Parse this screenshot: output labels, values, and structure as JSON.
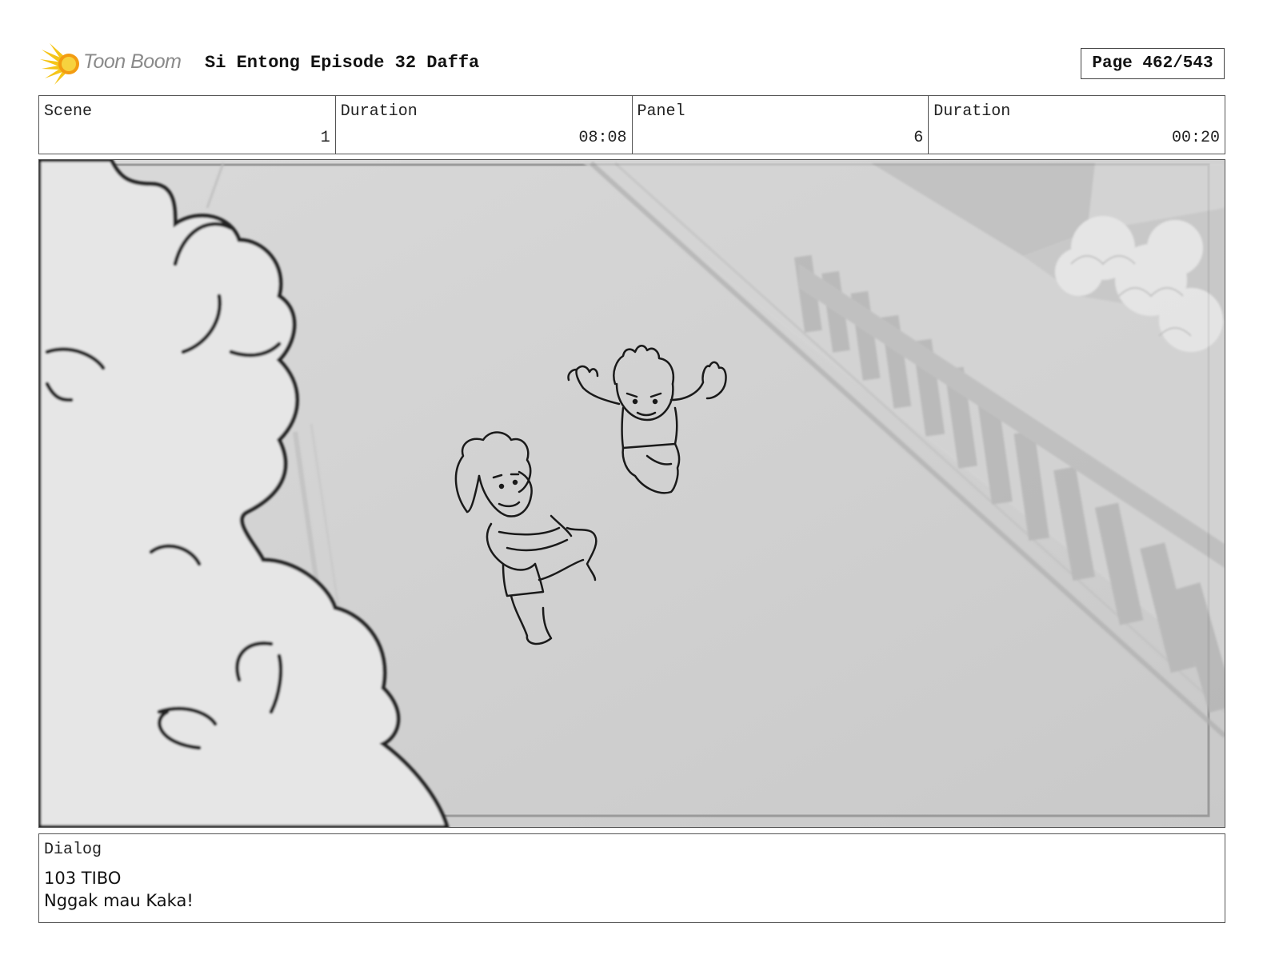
{
  "header": {
    "logo_text": "Toon Boom",
    "project_title": "Si Entong Episode 32 Daffa",
    "page": "Page 462/543"
  },
  "info": {
    "scene_label": "Scene",
    "scene_value": "1",
    "scene_duration_label": "Duration",
    "scene_duration_value": "08:08",
    "panel_label": "Panel",
    "panel_value": "6",
    "panel_duration_label": "Duration",
    "panel_duration_value": "00:20"
  },
  "dialog": {
    "label": "Dialog",
    "line1": "103 TIBO",
    "line2": "Nggak mau Kaka!"
  },
  "colors": {
    "logo_yellow": "#f5c518",
    "logo_orange": "#f39c12",
    "ground": "#cfcfcf",
    "bush": "#e6e6e6",
    "sketch": "#1a1a1a"
  }
}
